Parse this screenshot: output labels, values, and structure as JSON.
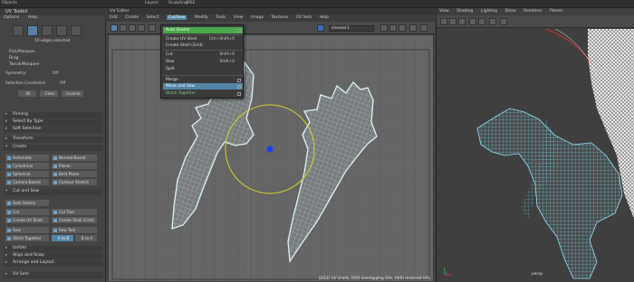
{
  "top_strip": {
    "items": [
      "Objects",
      "Layers",
      "Sculpting",
      "MSE"
    ]
  },
  "uv_toolkit": {
    "title": "UV Toolkit",
    "menu": [
      "Options",
      "Help"
    ],
    "selection_info": "10 edges selected",
    "pick_modes": [
      "Pick/Marquee",
      "Drag",
      "Tweak/Marquee"
    ],
    "symmetry_label": "Symmetry:",
    "symmetry_value": "Off",
    "sel_constraint_label": "Selection Constraint:",
    "sel_constraint_value": "Off",
    "sel_buttons": [
      "All",
      "Clear",
      "Inverse"
    ],
    "sections": {
      "pinning": "Pinning",
      "select_by_type": "Select By Type",
      "soft_selection": "Soft Selection",
      "transform": "Transform",
      "create": "Create",
      "cut_sew": "Cut and Sew",
      "unfold": "Unfold",
      "align_snap": "Align and Snap",
      "arrange_layout": "Arrange and Layout",
      "uv_sets": "UV Sets"
    },
    "create_buttons": [
      "Automatic",
      "Normal-Based",
      "Cylindrical",
      "Planar",
      "Spherical",
      "Best Plane",
      "Camera-Based",
      "Contour Stretch"
    ],
    "cut_sew_buttons": {
      "auto_seams": "Auto Seams",
      "cut": "Cut",
      "cut_tool": "Cut Tool",
      "create_uv_shell": "Create UV Shell",
      "create_shell_grid": "Create Shell (Grid)",
      "sew": "Sew",
      "sew_tool": "Sew Tool",
      "stitch_together": "Stitch Together",
      "a_to_b": "A to B",
      "b_to_a": "B to A"
    }
  },
  "uv_editor": {
    "title": "UV Editor",
    "menu": [
      "Edit",
      "Create",
      "Select",
      "Cut/Sew",
      "Modify",
      "Tools",
      "View",
      "Image",
      "Textures",
      "UV Sets",
      "Help"
    ],
    "active_menu": "Cut/Sew",
    "texture_name": "checker1",
    "status": "(2/12) UV shells, (0/0) overlapping UVs, (0/0) reversed UVs"
  },
  "cutsew_menu": {
    "items": [
      {
        "label": "Auto Seams",
        "shortcut": "",
        "highlight": true,
        "box": true
      },
      {
        "label": "Create UV Shell",
        "shortcut": "Ctrl+Shift+X",
        "highlight": false,
        "box": false
      },
      {
        "label": "Create Shell (Grid)",
        "shortcut": "",
        "highlight": false,
        "box": false
      },
      {
        "label": "Cut",
        "shortcut": "Shift+X",
        "highlight": false,
        "box": false
      },
      {
        "label": "Sew",
        "shortcut": "Shift+S",
        "highlight": false,
        "box": false
      },
      {
        "label": "Split",
        "shortcut": "",
        "highlight": false,
        "box": false
      },
      {
        "label": "Merge",
        "shortcut": "",
        "highlight": false,
        "box": true
      },
      {
        "label": "Move and Sew",
        "shortcut": "",
        "highlight": true,
        "box": true
      },
      {
        "label": "Stitch Together",
        "shortcut": "",
        "highlight": false,
        "box": true
      }
    ]
  },
  "viewport": {
    "menu": [
      "View",
      "Shading",
      "Lighting",
      "Show",
      "Renderer",
      "Panels"
    ],
    "camera_label": "persp"
  },
  "colors": {
    "accent": "#5285a6",
    "highlight_green": "#4aa84a",
    "uv_edge": "#bfe9f2",
    "manip_yellow": "#d8d22a",
    "manip_blue": "#1e3cff"
  }
}
